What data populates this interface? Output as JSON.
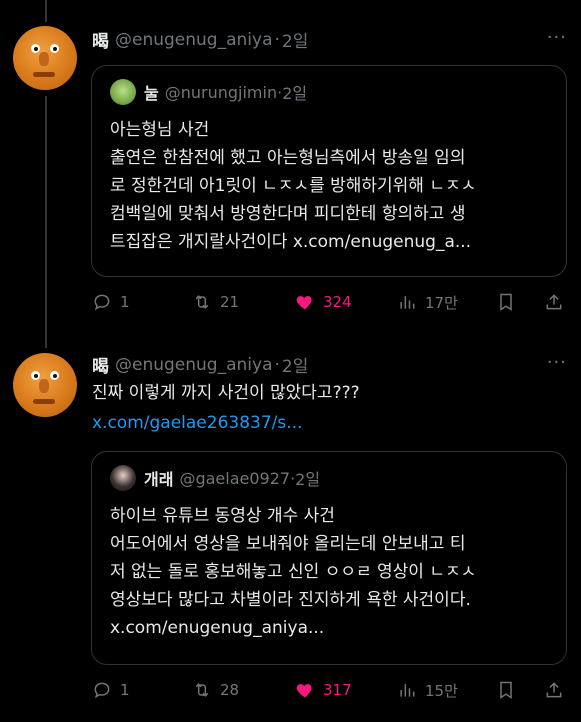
{
  "tweets": [
    {
      "author_name": "暍",
      "handle": "@enugenug_aniya",
      "dot": "·",
      "time": "2일",
      "more": "···",
      "text_lines": [],
      "quote": {
        "author_name": "눌",
        "handle": "@nurungjimin",
        "dot": "·",
        "time": "2일",
        "lines": [
          "아는형님 사건",
          "출연은 한참전에 했고 아는형님측에서 방송일 임의",
          "로 정한건데 아1릿이 ㄴㅈㅅ를 방해하기위해 ㄴㅈㅅ",
          "컴백일에 맞춰서 방영한다며 피디한테 항의하고 생",
          "트집잡은 개지랄사건이다 x.com/enugenug_a..."
        ]
      },
      "actions": {
        "replies": "1",
        "retweets": "21",
        "likes": "324",
        "views": "17만"
      }
    },
    {
      "author_name": "暍",
      "handle": "@enugenug_aniya",
      "dot": "·",
      "time": "2일",
      "more": "···",
      "text_lines": [
        "진짜 이렇게 까지 사건이 많았다고???"
      ],
      "link": "x.com/gaelae263837/s...",
      "quote": {
        "author_name": "개래",
        "handle": "@gaelae0927",
        "dot": "·",
        "time": "2일",
        "lines": [
          "하이브 유튜브 동영상 개수 사건",
          "어도어에서 영상을 보내줘야 올리는데 안보내고 티",
          "저 없는 돌로 홍보해놓고 신인 ㅇㅇㄹ 영상이 ㄴㅈㅅ",
          "영상보다 많다고 차별이라 진지하게 욕한 사건이다.",
          "x.com/enugenug_aniya..."
        ]
      },
      "actions": {
        "replies": "1",
        "retweets": "28",
        "likes": "317",
        "views": "15만"
      }
    }
  ],
  "colors": {
    "background": "#000000",
    "text": "#e7e9ea",
    "muted": "#71767b",
    "link": "#1d9bf0",
    "like": "#f91880",
    "border": "#2f3336"
  },
  "icons": [
    "reply-icon",
    "retweet-icon",
    "heart-filled-icon",
    "views-icon",
    "bookmark-icon",
    "share-icon"
  ]
}
